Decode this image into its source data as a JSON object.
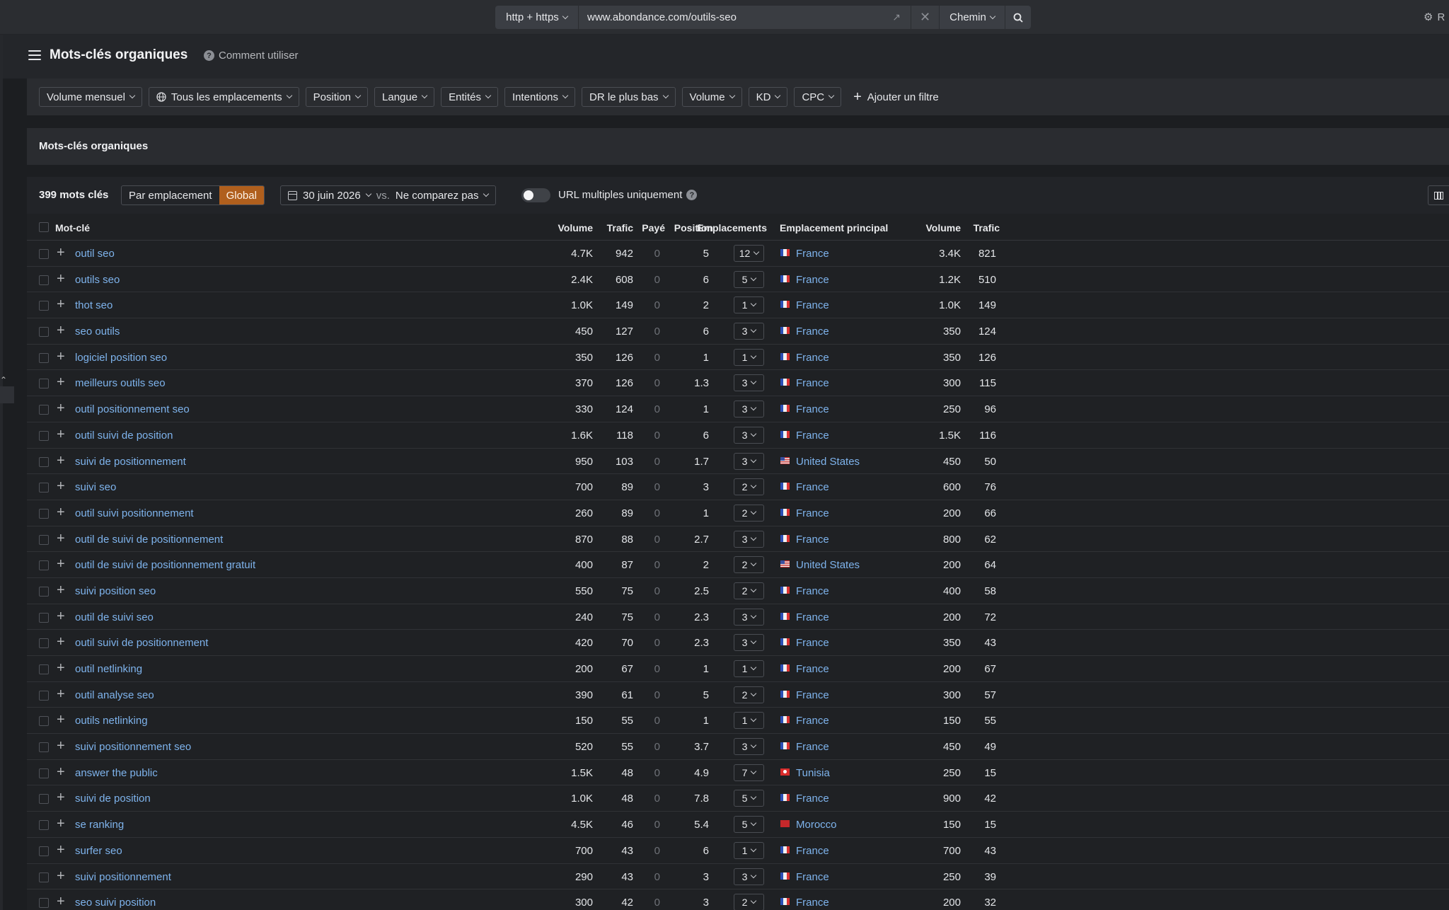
{
  "topbar": {
    "protocol": "http + https",
    "url": "www.abondance.com/outils-seo",
    "mode": "Chemin",
    "right_text": "R"
  },
  "header": {
    "title": "Mots-clés organiques",
    "help": "Comment utiliser"
  },
  "filters": [
    "Volume mensuel",
    "Tous les emplacements",
    "Position",
    "Langue",
    "Entités",
    "Intentions",
    "DR le plus bas",
    "Volume",
    "KD",
    "CPC"
  ],
  "add_filter": "Ajouter un filtre",
  "section_title": "Mots-clés organiques",
  "toolbar": {
    "count": "399 mots clés",
    "seg_location": "Par emplacement",
    "seg_global": "Global",
    "date": "30 juin 2026",
    "vs": "vs.",
    "compare": "Ne comparez pas",
    "multi_url": "URL multiples uniquement"
  },
  "columns": {
    "keyword": "Mot-clé",
    "volume": "Volume",
    "traffic": "Trafic",
    "paid": "Payé",
    "position": "Position",
    "locations": "Emplacements",
    "main_location": "Emplacement principal",
    "volume2": "Volume",
    "traffic2": "Trafic"
  },
  "rows": [
    {
      "kw": "outil seo",
      "vol": "4.7K",
      "tr": "942",
      "paid": "0",
      "pos": "5",
      "loc": "12",
      "country": "France",
      "flag": "fr",
      "vol2": "3.4K",
      "tr2": "821"
    },
    {
      "kw": "outils seo",
      "vol": "2.4K",
      "tr": "608",
      "paid": "0",
      "pos": "6",
      "loc": "5",
      "country": "France",
      "flag": "fr",
      "vol2": "1.2K",
      "tr2": "510"
    },
    {
      "kw": "thot seo",
      "vol": "1.0K",
      "tr": "149",
      "paid": "0",
      "pos": "2",
      "loc": "1",
      "country": "France",
      "flag": "fr",
      "vol2": "1.0K",
      "tr2": "149"
    },
    {
      "kw": "seo outils",
      "vol": "450",
      "tr": "127",
      "paid": "0",
      "pos": "6",
      "loc": "3",
      "country": "France",
      "flag": "fr",
      "vol2": "350",
      "tr2": "124"
    },
    {
      "kw": "logiciel position seo",
      "vol": "350",
      "tr": "126",
      "paid": "0",
      "pos": "1",
      "loc": "1",
      "country": "France",
      "flag": "fr",
      "vol2": "350",
      "tr2": "126"
    },
    {
      "kw": "meilleurs outils seo",
      "vol": "370",
      "tr": "126",
      "paid": "0",
      "pos": "1.3",
      "loc": "3",
      "country": "France",
      "flag": "fr",
      "vol2": "300",
      "tr2": "115"
    },
    {
      "kw": "outil positionnement seo",
      "vol": "330",
      "tr": "124",
      "paid": "0",
      "pos": "1",
      "loc": "3",
      "country": "France",
      "flag": "fr",
      "vol2": "250",
      "tr2": "96"
    },
    {
      "kw": "outil suivi de position",
      "vol": "1.6K",
      "tr": "118",
      "paid": "0",
      "pos": "6",
      "loc": "3",
      "country": "France",
      "flag": "fr",
      "vol2": "1.5K",
      "tr2": "116"
    },
    {
      "kw": "suivi de positionnement",
      "vol": "950",
      "tr": "103",
      "paid": "0",
      "pos": "1.7",
      "loc": "3",
      "country": "United States",
      "flag": "us",
      "vol2": "450",
      "tr2": "50"
    },
    {
      "kw": "suivi seo",
      "vol": "700",
      "tr": "89",
      "paid": "0",
      "pos": "3",
      "loc": "2",
      "country": "France",
      "flag": "fr",
      "vol2": "600",
      "tr2": "76"
    },
    {
      "kw": "outil suivi positionnement",
      "vol": "260",
      "tr": "89",
      "paid": "0",
      "pos": "1",
      "loc": "2",
      "country": "France",
      "flag": "fr",
      "vol2": "200",
      "tr2": "66"
    },
    {
      "kw": "outil de suivi de positionnement",
      "vol": "870",
      "tr": "88",
      "paid": "0",
      "pos": "2.7",
      "loc": "3",
      "country": "France",
      "flag": "fr",
      "vol2": "800",
      "tr2": "62"
    },
    {
      "kw": "outil de suivi de positionnement gratuit",
      "vol": "400",
      "tr": "87",
      "paid": "0",
      "pos": "2",
      "loc": "2",
      "country": "United States",
      "flag": "us",
      "vol2": "200",
      "tr2": "64"
    },
    {
      "kw": "suivi position seo",
      "vol": "550",
      "tr": "75",
      "paid": "0",
      "pos": "2.5",
      "loc": "2",
      "country": "France",
      "flag": "fr",
      "vol2": "400",
      "tr2": "58"
    },
    {
      "kw": "outil de suivi seo",
      "vol": "240",
      "tr": "75",
      "paid": "0",
      "pos": "2.3",
      "loc": "3",
      "country": "France",
      "flag": "fr",
      "vol2": "200",
      "tr2": "72"
    },
    {
      "kw": "outil suivi de positionnement",
      "vol": "420",
      "tr": "70",
      "paid": "0",
      "pos": "2.3",
      "loc": "3",
      "country": "France",
      "flag": "fr",
      "vol2": "350",
      "tr2": "43"
    },
    {
      "kw": "outil netlinking",
      "vol": "200",
      "tr": "67",
      "paid": "0",
      "pos": "1",
      "loc": "1",
      "country": "France",
      "flag": "fr",
      "vol2": "200",
      "tr2": "67"
    },
    {
      "kw": "outil analyse seo",
      "vol": "390",
      "tr": "61",
      "paid": "0",
      "pos": "5",
      "loc": "2",
      "country": "France",
      "flag": "fr",
      "vol2": "300",
      "tr2": "57"
    },
    {
      "kw": "outils netlinking",
      "vol": "150",
      "tr": "55",
      "paid": "0",
      "pos": "1",
      "loc": "1",
      "country": "France",
      "flag": "fr",
      "vol2": "150",
      "tr2": "55"
    },
    {
      "kw": "suivi positionnement seo",
      "vol": "520",
      "tr": "55",
      "paid": "0",
      "pos": "3.7",
      "loc": "3",
      "country": "France",
      "flag": "fr",
      "vol2": "450",
      "tr2": "49"
    },
    {
      "kw": "answer the public",
      "vol": "1.5K",
      "tr": "48",
      "paid": "0",
      "pos": "4.9",
      "loc": "7",
      "country": "Tunisia",
      "flag": "tn",
      "vol2": "250",
      "tr2": "15"
    },
    {
      "kw": "suivi de position",
      "vol": "1.0K",
      "tr": "48",
      "paid": "0",
      "pos": "7.8",
      "loc": "5",
      "country": "France",
      "flag": "fr",
      "vol2": "900",
      "tr2": "42"
    },
    {
      "kw": "se ranking",
      "vol": "4.5K",
      "tr": "46",
      "paid": "0",
      "pos": "5.4",
      "loc": "5",
      "country": "Morocco",
      "flag": "ma",
      "vol2": "150",
      "tr2": "15"
    },
    {
      "kw": "surfer seo",
      "vol": "700",
      "tr": "43",
      "paid": "0",
      "pos": "6",
      "loc": "1",
      "country": "France",
      "flag": "fr",
      "vol2": "700",
      "tr2": "43"
    },
    {
      "kw": "suivi positionnement",
      "vol": "290",
      "tr": "43",
      "paid": "0",
      "pos": "3",
      "loc": "3",
      "country": "France",
      "flag": "fr",
      "vol2": "250",
      "tr2": "39"
    },
    {
      "kw": "seo suivi position",
      "vol": "300",
      "tr": "42",
      "paid": "0",
      "pos": "3",
      "loc": "2",
      "country": "France",
      "flag": "fr",
      "vol2": "200",
      "tr2": "32"
    }
  ],
  "colors": {
    "accent_active": "#b05f1d",
    "link": "#7eb3ec"
  }
}
